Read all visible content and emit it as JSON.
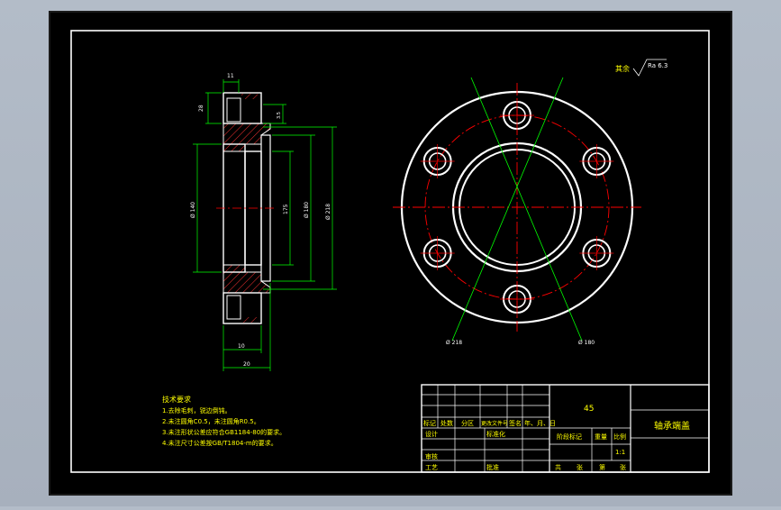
{
  "drawing": {
    "colors": {
      "app_bg": "#a9b2bf",
      "viewport_bg": "#000000",
      "outline": "#ffffff",
      "dimension": "#00ff00",
      "hatch": "#ff2a2a",
      "centerline": "#ff0000",
      "annotation": "#ffff00"
    },
    "roughness_note": {
      "label": "其余",
      "value": "Ra 6.3"
    },
    "side_view_dims": {
      "top_width": "11",
      "flange_height": "28",
      "step_height": "3.5",
      "bore_dia": "Ø 140",
      "mid_dia": "175",
      "pitch_dia": "Ø 180",
      "outer_dia": "Ø 218",
      "bottom_width_1": "10",
      "bottom_width_2": "20"
    },
    "front_view_dims": {
      "left_leader": "Ø 218",
      "right_leader": "Ø 180"
    },
    "tech_requirements": {
      "title": "技术要求",
      "items": [
        "1.去除毛刺，锐边倒钝。",
        "2.未注圆角C0.5，未注圆角R0.5。",
        "3.未注形状公差应符合GB1184-80的要求。",
        "4.未注尺寸公差按GB/T1804-m的要求。"
      ]
    },
    "title_block": {
      "material": "45",
      "part_name": "轴承端盖",
      "rev_header": [
        "标记",
        "处数",
        "分区",
        "更改文件号",
        "签名",
        "年、月、日"
      ],
      "row_design": "设计",
      "row_standard": "标准化",
      "row_check": "审核",
      "row_process": "工艺",
      "row_approve": "批准",
      "stage_label": "阶段标记",
      "weight_label": "重量",
      "scale_label": "比例",
      "scale_value": "1:1",
      "sheet_row": [
        "共",
        "张",
        "第",
        "张"
      ]
    }
  }
}
